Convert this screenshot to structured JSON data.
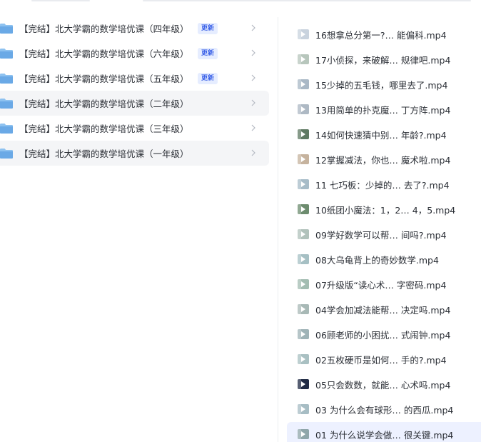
{
  "folders": [
    {
      "name": "【完结】北大学霸的数学培优课（四年级）",
      "badge": "更新"
    },
    {
      "name": "【完结】北大学霸的数学培优课（六年级）",
      "badge": "更新"
    },
    {
      "name": "【完结】北大学霸的数学培优课（五年级）",
      "badge": "更新"
    },
    {
      "name": "【完结】北大学霸的数学培优课（二年级）",
      "badge": ""
    },
    {
      "name": "【完结】北大学霸的数学培优课（三年级）",
      "badge": ""
    },
    {
      "name": "【完结】北大学霸的数学培优课（一年级）",
      "badge": ""
    }
  ],
  "files": [
    {
      "name": "16想拿总分第一?…  能偏科.mp4",
      "thumb": "#c9d3de"
    },
    {
      "name": "17小侦探，来破解…  规律吧.mp4",
      "thumb": "#b7c6bc"
    },
    {
      "name": "15少掉的五毛钱，哪里去了.mp4",
      "thumb": "#a9b8c6"
    },
    {
      "name": "13用简单的扑克魔…  丁方阵.mp4",
      "thumb": "#aeb9c4"
    },
    {
      "name": "14如何快速猜中别…  年龄?.mp4",
      "thumb": "#5f7a63"
    },
    {
      "name": "12掌握减法，你也…  魔术啦.mp4",
      "thumb": "#c6b39e"
    },
    {
      "name": "11 七巧板：少掉的…  去了?.mp4",
      "thumb": "#a7bcc8"
    },
    {
      "name": "10纸团小魔法：1，2…  4，5.mp4",
      "thumb": "#6d8c6f"
    },
    {
      "name": "09学好数学可以帮…  间吗?.mp4",
      "thumb": "#b1c2bb"
    },
    {
      "name": "08大乌龟背上的奇妙数学.mp4",
      "thumb": "#a6c0c4"
    },
    {
      "name": "07升级版“读心术…  字密码.mp4",
      "thumb": "#a3bdb2"
    },
    {
      "name": "04学会加减法能帮…  决定吗.mp4",
      "thumb": "#a8b9b6"
    },
    {
      "name": "06顾老师的小困扰…  式闹钟.mp4",
      "thumb": "#9fb3b7"
    },
    {
      "name": "02五枚硬币是如何…  手的?.mp4",
      "thumb": "#a9c0c2"
    },
    {
      "name": "05只会数数，就能…  心术吗.mp4",
      "thumb": "#1f2a44"
    },
    {
      "name": "03 为什么会有球形…  的西瓜.mp4",
      "thumb": "#a7bdc4"
    },
    {
      "name": "01 为什么说学会做…  很关键.mp4",
      "thumb": "#8fa6aa"
    }
  ],
  "colors": {
    "accent": "#3d63e8",
    "badge_bg": "#e6edff",
    "selected_row": "#edf1ff",
    "folder": "#7fb4ea"
  }
}
